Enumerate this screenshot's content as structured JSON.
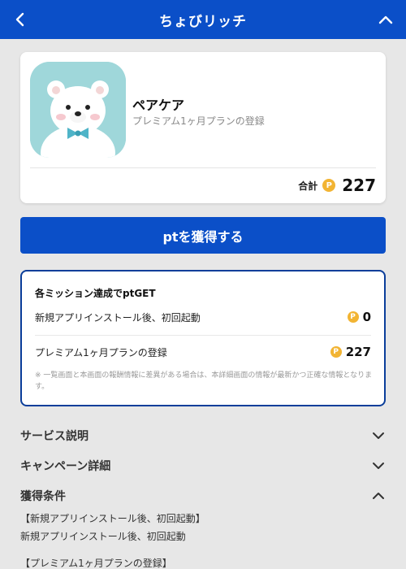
{
  "header": {
    "title": "ちょびリッチ",
    "back_icon": "chevron-left-icon",
    "collapse_icon": "chevron-up-icon",
    "bg_color": "#0b4fc8"
  },
  "app": {
    "name": "ペアケア",
    "subtitle": "プレミアム1ヶ月プランの登録",
    "icon": "polar-bear-app-icon",
    "total_label": "合計",
    "total_points": "227",
    "coin_glyph": "P"
  },
  "cta": {
    "label": "ptを獲得する"
  },
  "missions": {
    "title": "各ミッション達成でptGET",
    "items": [
      {
        "label": "新規アプリインストール後、初回起動",
        "points": "0"
      },
      {
        "label": "プレミアム1ヶ月プランの登録",
        "points": "227"
      }
    ],
    "note": "※ 一覧画面と本画面の報酬情報に差異がある場合は、本詳細画面の情報が最新かつ正確な情報となります。"
  },
  "sections": [
    {
      "label": "サービス説明",
      "state": "collapsed"
    },
    {
      "label": "キャンペーン詳細",
      "state": "collapsed"
    },
    {
      "label": "獲得条件",
      "state": "expanded"
    }
  ],
  "conditions": {
    "heading1": "【新規アプリインストール後、初回起動】",
    "body1": "新規アプリインストール後、初回起動",
    "heading2": "【プレミアム1ヶ月プランの登録】"
  },
  "colors": {
    "brand_blue": "#0b4fc8",
    "coin_gold": "#f2b433",
    "mission_border": "#0b3e9a"
  }
}
